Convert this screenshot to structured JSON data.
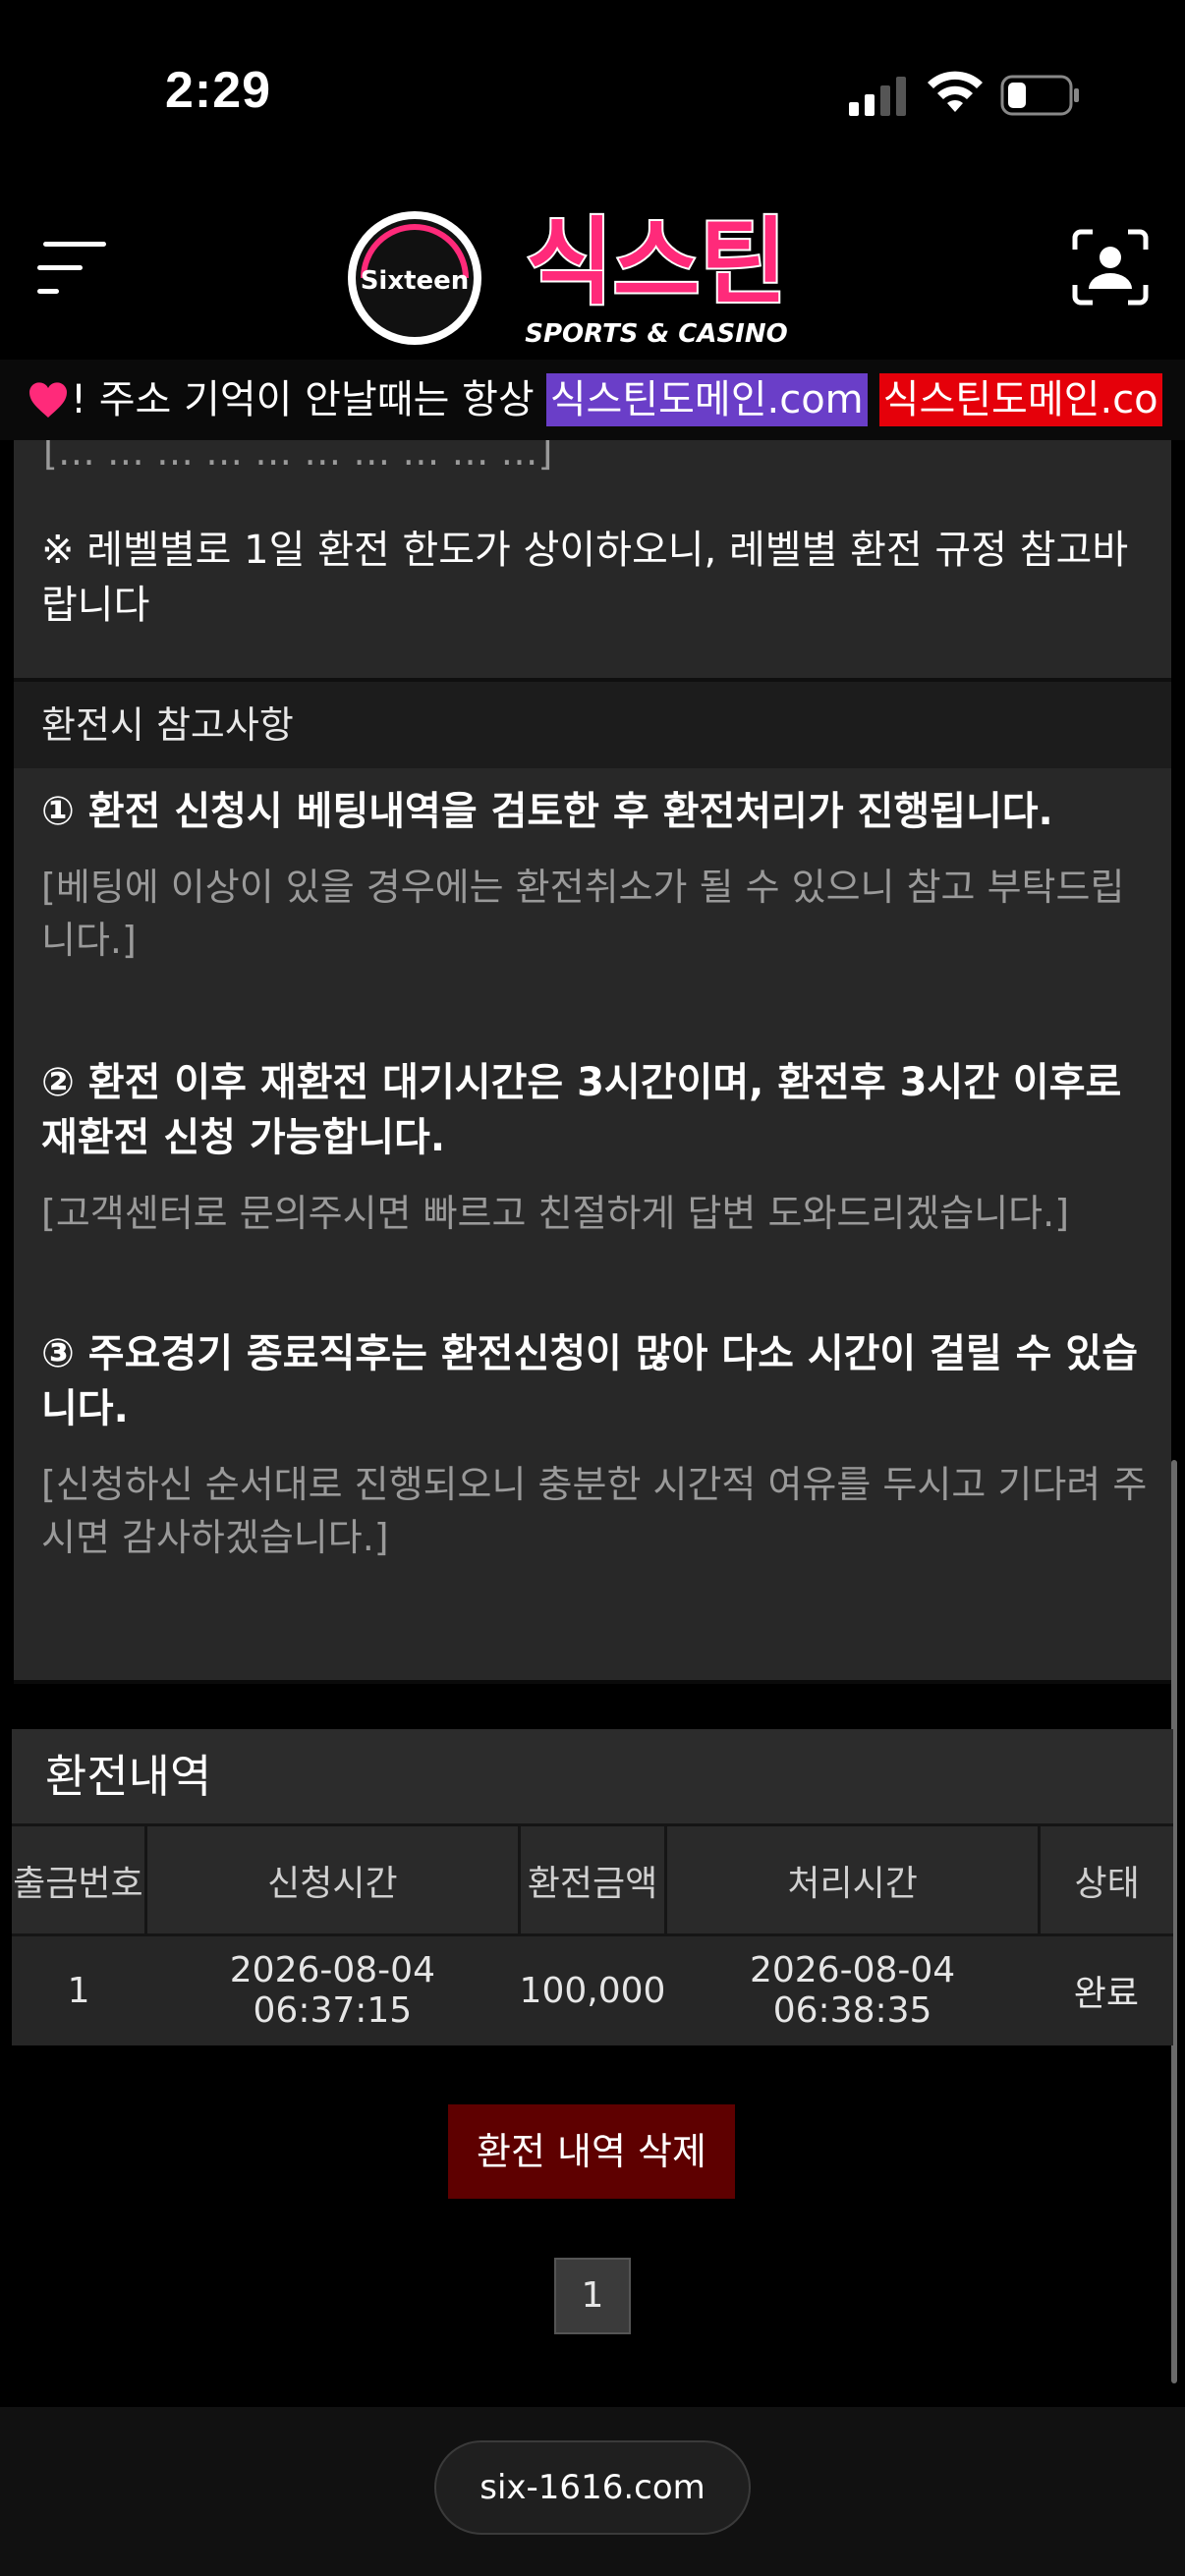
{
  "status": {
    "time": "2:29"
  },
  "header": {
    "logo_badge": "Sixteen",
    "logo_title": "식스틴",
    "logo_subtitle": "SPORTS & CASINO"
  },
  "marquee": {
    "text": "! 주소 기억이 안날때는 항상",
    "domain1": "식스틴도메인.com",
    "domain2": "식스틴도메인.co"
  },
  "content": {
    "cut_text": "[… … … … … … … … … …]",
    "notice": "※ 레벨별로 1일 환전 한도가 상이하오니, 레벨별 환전 규정 참고바랍니다",
    "section_title": "환전시 참고사항",
    "items": [
      {
        "title": "① 환전 신청시 베팅내역을 검토한 후 환전처리가 진행됩니다.",
        "desc": "[베팅에 이상이 있을 경우에는 환전취소가 될 수 있으니 참고 부탁드립니다.]"
      },
      {
        "title": "② 환전 이후 재환전 대기시간은 3시간이며, 환전후 3시간 이후로 재환전 신청 가능합니다.",
        "desc": "[고객센터로 문의주시면 빠르고 친절하게 답변 도와드리겠습니다.]"
      },
      {
        "title": "③ 주요경기 종료직후는 환전신청이 많아 다소 시간이 걸릴 수 있습니다.",
        "desc": "[신청하신 순서대로 진행되오니 충분한 시간적 여유를 두시고 기다려 주시면 감사하겠습니다.]"
      }
    ]
  },
  "history": {
    "title": "환전내역",
    "columns": [
      "출금번호",
      "신청시간",
      "환전금액",
      "처리시간",
      "상태"
    ],
    "rows": [
      [
        "1",
        "2026-08-04 06:37:15",
        "100,000",
        "2026-08-04 06:38:35",
        "완료"
      ]
    ],
    "delete_label": "환전 내역 삭제",
    "page": "1"
  },
  "browser": {
    "url": "six-1616.com"
  },
  "colors": {
    "accent_pink": "#ff2a7a",
    "highlight_purple": "#6a3ec8",
    "highlight_red": "#e5000a",
    "delete_red": "#5e0000"
  }
}
